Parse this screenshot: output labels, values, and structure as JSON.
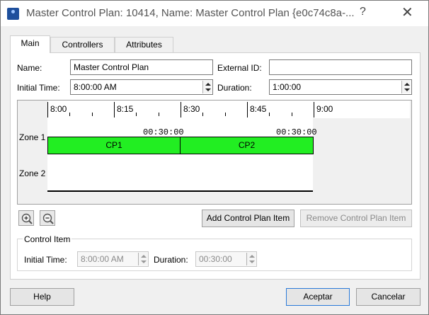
{
  "window": {
    "title": "Master Control Plan: 10414, Name: Master Control Plan  {e0c74c8a-...",
    "help_glyph": "?",
    "close_glyph": "✕"
  },
  "tabs": [
    {
      "label": "Main",
      "active": true
    },
    {
      "label": "Controllers",
      "active": false
    },
    {
      "label": "Attributes",
      "active": false
    }
  ],
  "form": {
    "name_label": "Name:",
    "name_value": "Master Control Plan",
    "external_id_label": "External ID:",
    "external_id_value": "",
    "initial_time_label": "Initial Time:",
    "initial_time_value": "8:00:00 AM",
    "duration_label": "Duration:",
    "duration_value": "1:00:00"
  },
  "timeline": {
    "ticks": [
      "8:00",
      "8:15",
      "8:30",
      "8:45",
      "9:00"
    ],
    "zones": [
      "Zone 1",
      "Zone 2"
    ],
    "items": [
      {
        "label": "CP1",
        "duration": "00:30:00",
        "color": "#22ee22"
      },
      {
        "label": "CP2",
        "duration": "00:30:00",
        "color": "#22ee22"
      }
    ]
  },
  "toolbar": {
    "zoom_in_icon": "zoom-in-icon",
    "zoom_out_icon": "zoom-out-icon",
    "add_label": "Add Control Plan Item",
    "remove_label": "Remove Control Plan Item"
  },
  "control_item": {
    "title": "Control Item",
    "initial_time_label": "Initial Time:",
    "initial_time_value": "8:00:00 AM",
    "duration_label": "Duration:",
    "duration_value": "00:30:00"
  },
  "footer": {
    "help_label": "Help",
    "accept_label": "Aceptar",
    "cancel_label": "Cancelar"
  }
}
